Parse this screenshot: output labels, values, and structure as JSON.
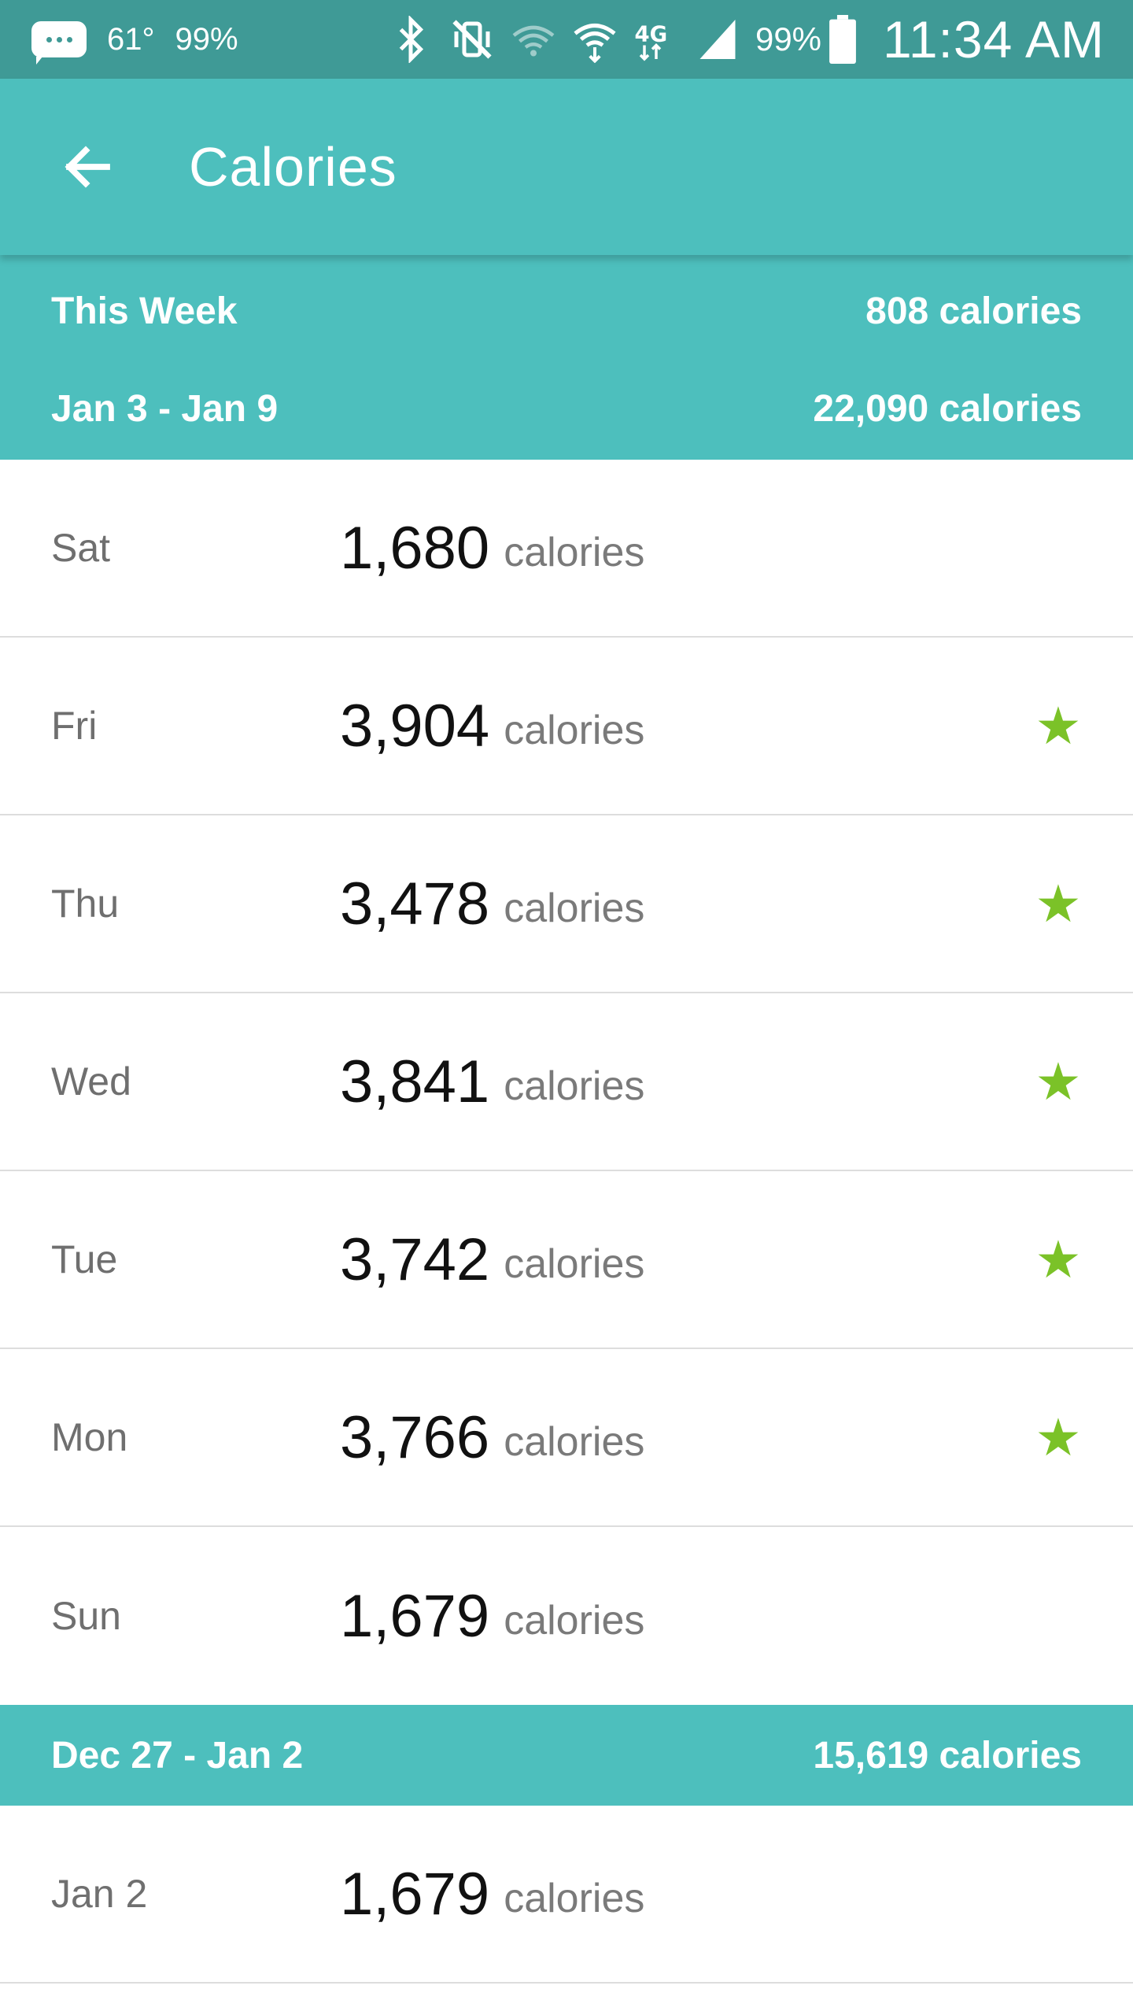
{
  "status_bar": {
    "temperature": "61°",
    "notif_percent": "99%",
    "battery_percent": "99%",
    "time": "11:34 AM"
  },
  "app_bar": {
    "title": "Calories"
  },
  "summary": {
    "this_week_label": "This Week",
    "this_week_value": "808 calories"
  },
  "weeks": [
    {
      "range": "Jan 3 - Jan 9",
      "total": "22,090 calories",
      "days": [
        {
          "day": "Sat",
          "value": "1,680",
          "unit": "calories",
          "goal_met": false
        },
        {
          "day": "Fri",
          "value": "3,904",
          "unit": "calories",
          "goal_met": true
        },
        {
          "day": "Thu",
          "value": "3,478",
          "unit": "calories",
          "goal_met": true
        },
        {
          "day": "Wed",
          "value": "3,841",
          "unit": "calories",
          "goal_met": true
        },
        {
          "day": "Tue",
          "value": "3,742",
          "unit": "calories",
          "goal_met": true
        },
        {
          "day": "Mon",
          "value": "3,766",
          "unit": "calories",
          "goal_met": true
        },
        {
          "day": "Sun",
          "value": "1,679",
          "unit": "calories",
          "goal_met": false
        }
      ]
    },
    {
      "range": "Dec 27 - Jan 2",
      "total": "15,619 calories",
      "days": [
        {
          "day": "Jan 2",
          "value": "1,679",
          "unit": "calories",
          "goal_met": false
        }
      ]
    }
  ],
  "colors": {
    "status_bar": "#3f9a96",
    "teal": "#4dbfbd",
    "star": "#7bc228"
  },
  "icons": {
    "star": "★"
  }
}
